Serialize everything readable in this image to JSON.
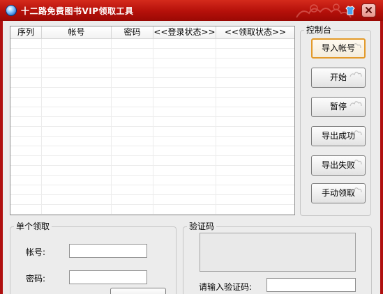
{
  "window": {
    "title": "十二路免费图书VIP领取工具"
  },
  "icons": {
    "app": "app-globe-icon",
    "skin": "skin-shirt-icon",
    "close": "close-icon"
  },
  "list": {
    "columns": [
      "序列",
      "帐号",
      "密码",
      "<<登录状态>>",
      "<<领取状态>>"
    ],
    "rows": []
  },
  "control_panel": {
    "title": "控制台",
    "buttons": [
      "导入帐号",
      "开始",
      "暂停",
      "导出成功",
      "导出失败",
      "手动领取"
    ]
  },
  "single": {
    "title": "单个领取",
    "account_label": "帐号:",
    "account_value": "",
    "password_label": "密码:",
    "password_value": ""
  },
  "captcha": {
    "title": "验证码",
    "input_label": "请输入验证码:",
    "input_value": ""
  },
  "colors": {
    "titlebar": "#b5100a",
    "client_bg": "#ececec",
    "focus_border": "#e39a2a"
  }
}
